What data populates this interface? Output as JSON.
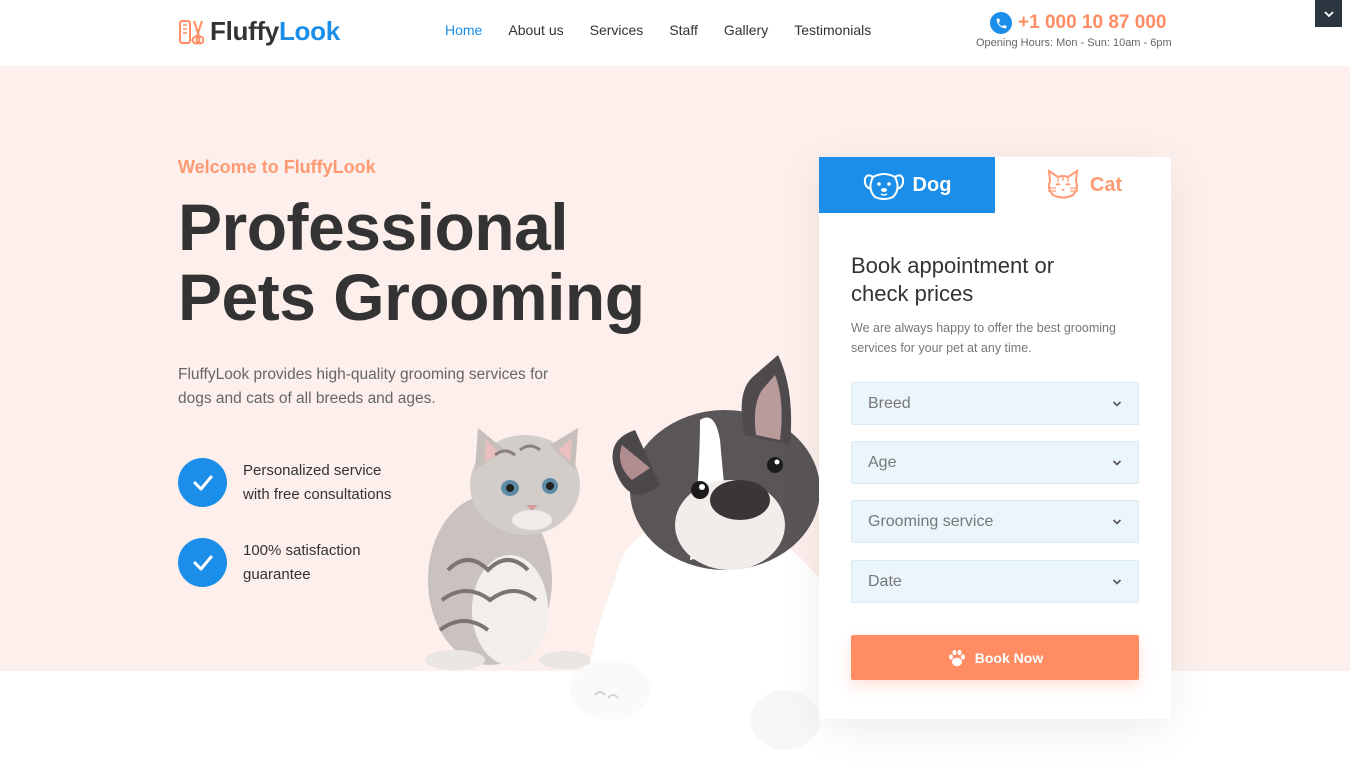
{
  "brand": {
    "name_a": "Fluffy",
    "name_b": "Look"
  },
  "nav": {
    "items": [
      "Home",
      "About us",
      "Services",
      "Staff",
      "Gallery",
      "Testimonials"
    ],
    "active": "Home"
  },
  "contact": {
    "phone": "+1 000 10 87 000",
    "hours": "Opening Hours: Mon - Sun: 10am - 6pm"
  },
  "hero": {
    "welcome": "Welcome to FluffyLook",
    "title_line1": "Professional",
    "title_line2": "Pets Grooming",
    "description": "FluffyLook provides high-quality grooming services for dogs and cats of all breeds and ages.",
    "features": [
      {
        "line1": "Personalized service",
        "line2": "with free consultations"
      },
      {
        "line1": "100% satisfaction",
        "line2": "guarantee"
      }
    ]
  },
  "booking": {
    "tabs": {
      "dog": "Dog",
      "cat": "Cat",
      "active": "Dog"
    },
    "title": "Book appointment or check prices",
    "description": "We are always happy to offer the best grooming services for your pet at any time.",
    "fields": {
      "breed": "Breed",
      "age": "Age",
      "service": "Grooming service",
      "date": "Date"
    },
    "button": "Book Now"
  },
  "colors": {
    "primary": "#1a8ee8",
    "accent": "#ff8c63",
    "hero_bg": "#fcefec"
  },
  "icons": {
    "logo": "scissors-comb-icon",
    "phone": "phone-icon",
    "check": "check-icon",
    "dog": "dog-face-icon",
    "cat": "cat-face-icon",
    "chevron": "chevron-down-icon",
    "paw": "paw-icon"
  }
}
